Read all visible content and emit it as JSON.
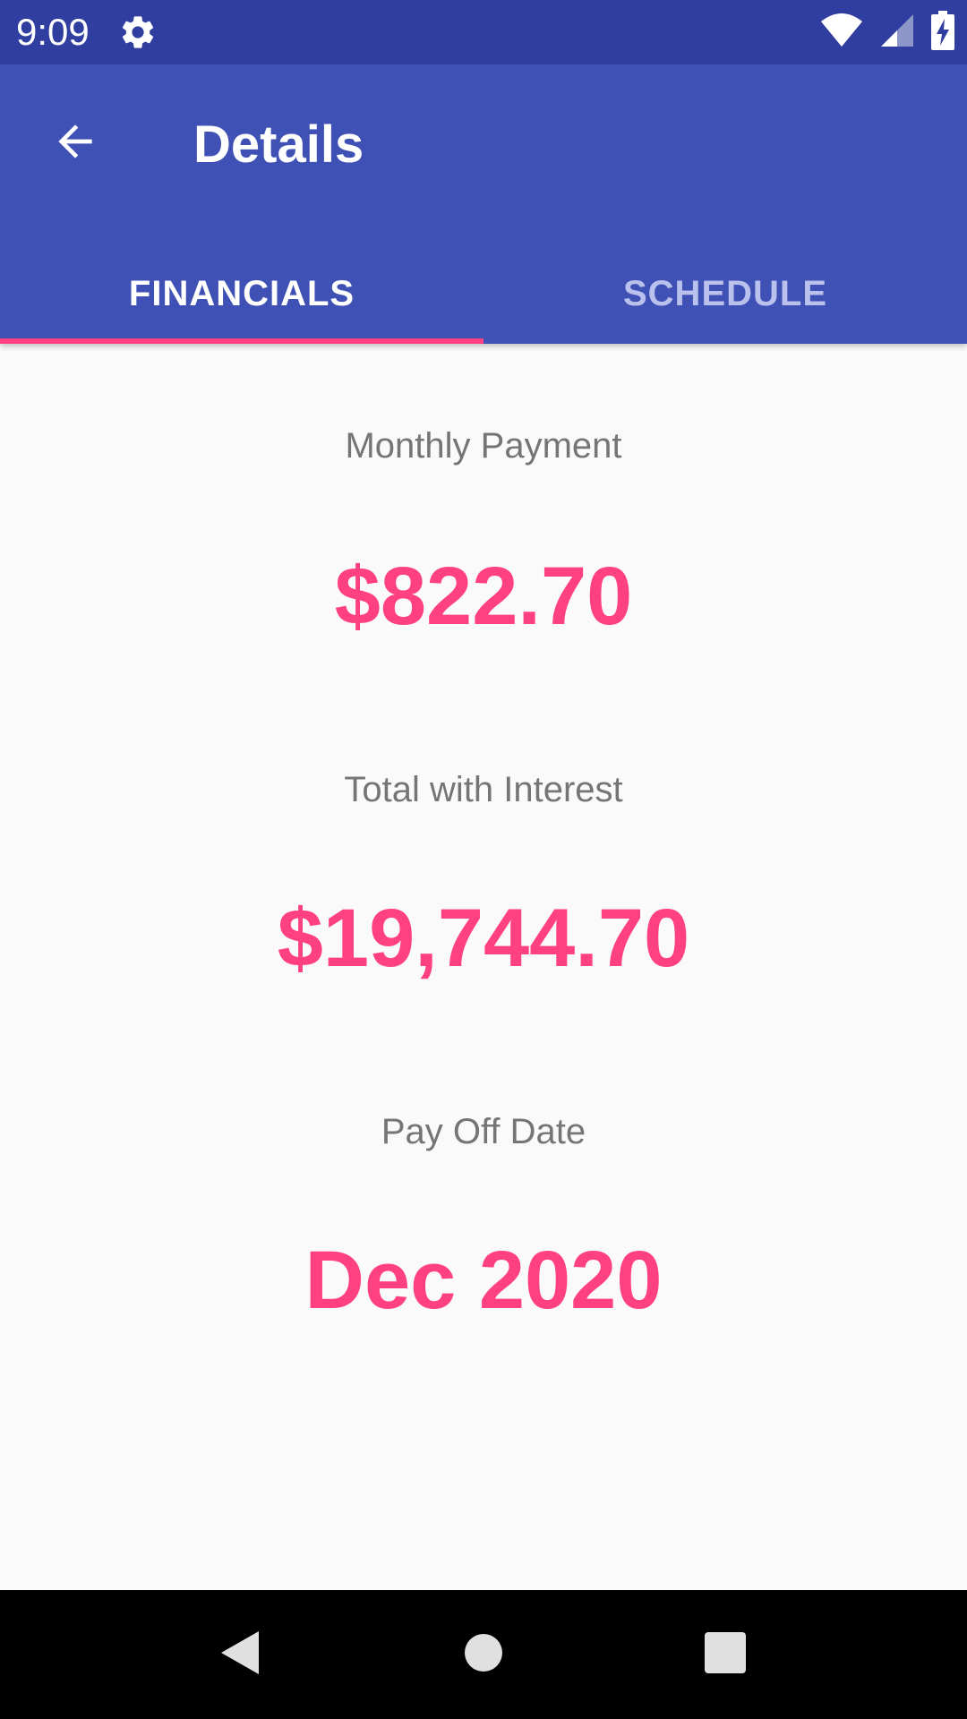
{
  "status_bar": {
    "time": "9:09",
    "icons": [
      "settings-gear-icon",
      "wifi-icon",
      "cell-signal-icon",
      "battery-charging-icon"
    ]
  },
  "app_bar": {
    "title": "Details",
    "back_icon": "arrow-back-icon"
  },
  "tabs": [
    {
      "label": "FINANCIALS",
      "active": true
    },
    {
      "label": "SCHEDULE",
      "active": false
    }
  ],
  "financials": {
    "monthly_payment_label": "Monthly Payment",
    "monthly_payment_value": "$822.70",
    "total_with_interest_label": "Total with Interest",
    "total_with_interest_value": "$19,744.70",
    "pay_off_date_label": "Pay Off Date",
    "pay_off_date_value": "Dec 2020"
  },
  "nav_bar": {
    "icons": [
      "nav-back-icon",
      "nav-home-icon",
      "nav-recents-icon"
    ]
  },
  "colors": {
    "status_bar": "#303f9f",
    "primary": "#3f51b5",
    "accent": "#ff4081",
    "label_text": "#757575",
    "background": "#fafafa"
  }
}
